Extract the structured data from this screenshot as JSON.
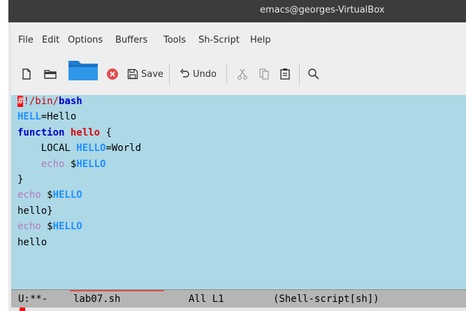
{
  "window": {
    "title": "emacs@georges-VirtualBox"
  },
  "menu": [
    "File",
    "Edit",
    "Options",
    "Buffers",
    "Tools",
    "Sh-Script",
    "Help"
  ],
  "toolbar": {
    "save_label": "Save",
    "undo_label": "Undo",
    "icons": [
      "new-file-icon",
      "open-file-icon",
      "folder-icon",
      "close-icon",
      "save-icon",
      "undo-icon",
      "cut-icon",
      "copy-icon",
      "paste-icon",
      "search-icon"
    ]
  },
  "editor": {
    "lines": [
      {
        "segments": [
          {
            "text": "#",
            "style": "cursor-block"
          },
          {
            "text": "!/bin/",
            "style": "cmt"
          },
          {
            "text": "bash",
            "style": "kw"
          }
        ]
      },
      {
        "segments": [
          {
            "text": "HELL",
            "style": "var"
          },
          {
            "text": "=Hello",
            "style": "plain"
          }
        ]
      },
      {
        "segments": [
          {
            "text": "function",
            "style": "kw"
          },
          {
            "text": " ",
            "style": "plain"
          },
          {
            "text": "hello",
            "style": "fn"
          },
          {
            "text": " {",
            "style": "plain"
          }
        ]
      },
      {
        "segments": [
          {
            "text": "    LOCAL ",
            "style": "plain"
          },
          {
            "text": "HELLO",
            "style": "var"
          },
          {
            "text": "=World",
            "style": "plain"
          }
        ]
      },
      {
        "segments": [
          {
            "text": "    ",
            "style": "plain"
          },
          {
            "text": "echo",
            "style": "bi"
          },
          {
            "text": " $",
            "style": "plain"
          },
          {
            "text": "HELLO",
            "style": "var"
          }
        ]
      },
      {
        "segments": [
          {
            "text": "}",
            "style": "plain"
          }
        ]
      },
      {
        "segments": [
          {
            "text": "echo",
            "style": "bi"
          },
          {
            "text": " $",
            "style": "plain"
          },
          {
            "text": "HELLO",
            "style": "var"
          }
        ]
      },
      {
        "segments": [
          {
            "text": "hello}",
            "style": "plain"
          }
        ]
      },
      {
        "segments": [
          {
            "text": "echo",
            "style": "bi"
          },
          {
            "text": " $",
            "style": "plain"
          },
          {
            "text": "HELLO",
            "style": "var"
          }
        ]
      },
      {
        "segments": [
          {
            "text": "hello",
            "style": "plain"
          }
        ]
      }
    ]
  },
  "modeline": {
    "status": "U:**-",
    "buffer_name": "lab07.sh",
    "position": "All L1",
    "mode": "(Shell-script[sh])"
  },
  "colors": {
    "editor_background": "#add8e6",
    "keyword": "#0000cd",
    "variable": "#1e90ff",
    "function_name": "#e00000",
    "builtin": "#b57cc0",
    "cursor": "#ff0000"
  }
}
